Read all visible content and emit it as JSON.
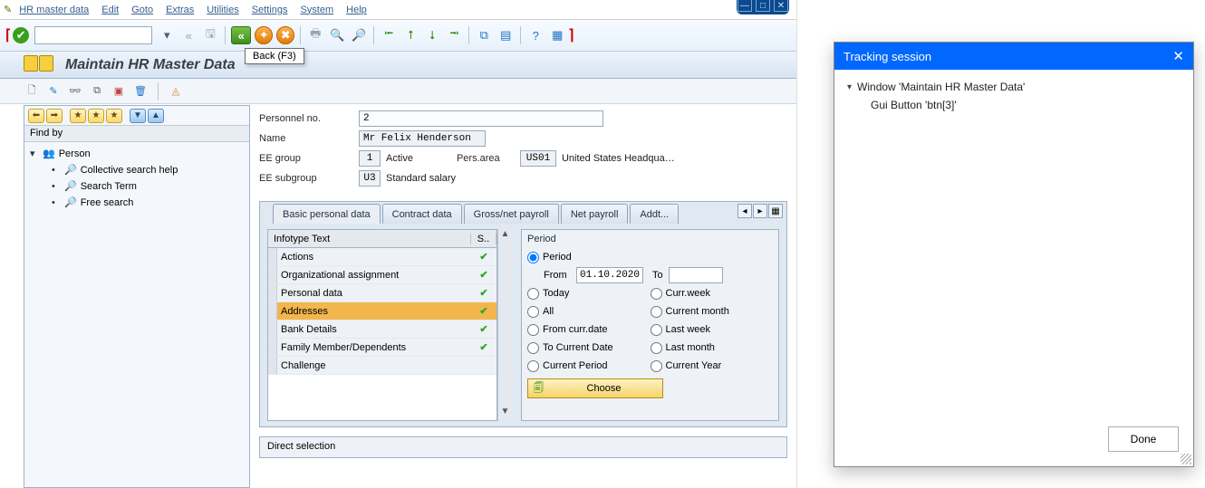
{
  "menu": {
    "items": [
      "HR master data",
      "Edit",
      "Goto",
      "Extras",
      "Utilities",
      "Settings",
      "System",
      "Help"
    ]
  },
  "tooltip": {
    "back": "Back   (F3)"
  },
  "title": "Maintain HR Master Data",
  "findby": {
    "label": "Find by",
    "root": "Person",
    "children": [
      "Collective search help",
      "Search Term",
      "Free search"
    ]
  },
  "header": {
    "pernr_label": "Personnel no.",
    "pernr": "2",
    "name_label": "Name",
    "name": "Mr Felix Henderson",
    "eegrp_label": "EE group",
    "eegrp_code": "1",
    "eegrp_text": "Active",
    "persarea_label": "Pers.area",
    "persarea_code": "US01",
    "persarea_text": "United States Headqua…",
    "eesub_label": "EE subgroup",
    "eesub_code": "U3",
    "eesub_text": "Standard salary"
  },
  "tabs": [
    "Basic personal data",
    "Contract data",
    "Gross/net payroll",
    "Net payroll",
    "Addt..."
  ],
  "infotype": {
    "hdr_text": "Infotype Text",
    "hdr_status": "S..",
    "rows": [
      {
        "t": "Actions",
        "s": true
      },
      {
        "t": "Organizational assignment",
        "s": true
      },
      {
        "t": "Personal data",
        "s": true
      },
      {
        "t": "Addresses",
        "s": true,
        "sel": true
      },
      {
        "t": "Bank Details",
        "s": true
      },
      {
        "t": "Family Member/Dependents",
        "s": true
      },
      {
        "t": "Challenge",
        "s": false
      }
    ]
  },
  "period": {
    "title": "Period",
    "r_period": "Period",
    "from_label": "From",
    "from": "01.10.2020",
    "to_label": "To",
    "to": "",
    "r_today": "Today",
    "r_currweek": "Curr.week",
    "r_all": "All",
    "r_currmonth": "Current month",
    "r_fromcurr": "From curr.date",
    "r_lastweek": "Last week",
    "r_tocurr": "To Current Date",
    "r_lastmonth": "Last month",
    "r_currper": "Current Period",
    "r_curryear": "Current Year",
    "choose": "Choose"
  },
  "directsel": "Direct selection",
  "tracking": {
    "title": "Tracking session",
    "win": "Window 'Maintain HR Master Data'",
    "item": "Gui Button 'btn[3]'",
    "done": "Done"
  }
}
